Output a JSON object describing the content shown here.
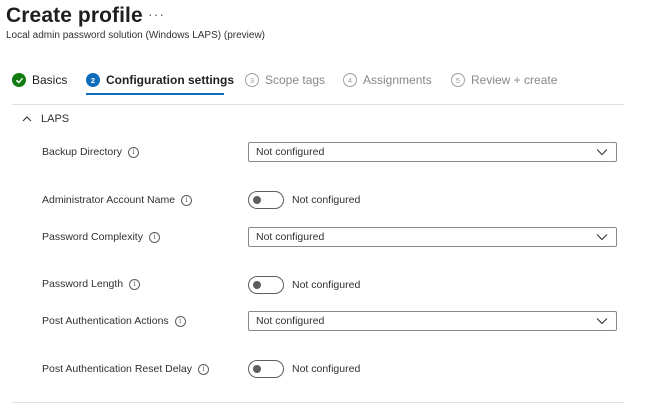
{
  "header": {
    "title": "Create profile",
    "more": "···",
    "subtitle": "Local admin password solution (Windows LAPS) (preview)"
  },
  "wizard": {
    "steps": [
      {
        "number": "",
        "label": "Basics",
        "state": "done"
      },
      {
        "number": "2",
        "label": "Configuration settings",
        "state": "active"
      },
      {
        "number": "3",
        "label": "Scope tags",
        "state": "pending"
      },
      {
        "number": "4",
        "label": "Assignments",
        "state": "pending"
      },
      {
        "number": "5",
        "label": "Review + create",
        "state": "pending"
      }
    ]
  },
  "section": {
    "title": "LAPS",
    "expanded": true
  },
  "settings": [
    {
      "label": "Backup Directory",
      "control": "dropdown",
      "value": "Not configured"
    },
    {
      "label": "Administrator Account Name",
      "control": "toggle",
      "value": "Not configured"
    },
    {
      "label": "Password Complexity",
      "control": "dropdown",
      "value": "Not configured"
    },
    {
      "label": "Password Length",
      "control": "toggle",
      "value": "Not configured"
    },
    {
      "label": "Post Authentication Actions",
      "control": "dropdown",
      "value": "Not configured"
    },
    {
      "label": "Post Authentication Reset Delay",
      "control": "toggle",
      "value": "Not configured"
    }
  ],
  "icons": {
    "info": "i",
    "check": "✓"
  },
  "colors": {
    "accent": "#0f6cbd",
    "success": "#107c10",
    "border": "#8a8886",
    "divider": "#e1dfdd"
  }
}
